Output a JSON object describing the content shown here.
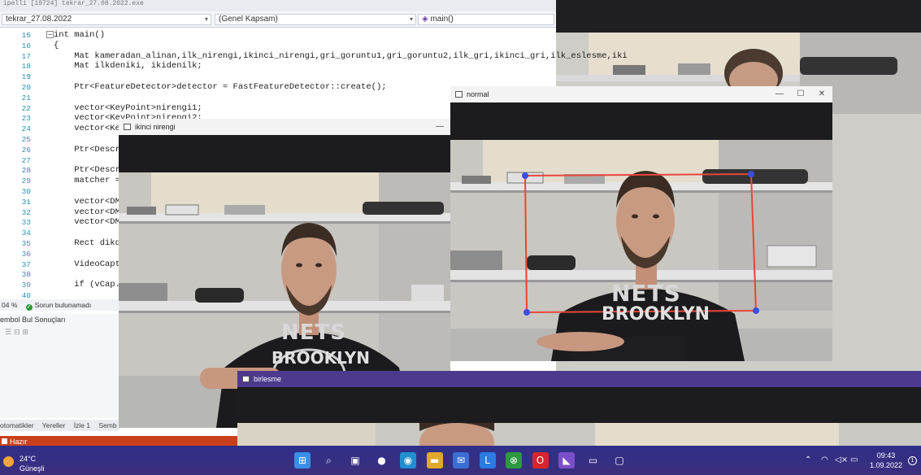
{
  "editor": {
    "tab_text": "ipelli  [19724] tekrar_27.08.2022.exe",
    "file_dropdown": "tekrar_27.08.2022",
    "scope_dropdown": "(Genel Kapsam)",
    "function_dropdown": "main()",
    "lines": [
      {
        "no": "15",
        "code": "int main()"
      },
      {
        "no": "16",
        "code": "{"
      },
      {
        "no": "17",
        "code": "    Mat kameradan_alinan,ilk_nirengi,ikinci_nirengi,gri_goruntu1,gri_goruntu2,ilk_gri,ikinci_gri,ilk_eslesme,iki"
      },
      {
        "no": "18",
        "code": "    Mat ilkdeniki, ikidenilk;"
      },
      {
        "no": "19",
        "code": ""
      },
      {
        "no": "20",
        "code": "    Ptr<FeatureDetector>detector = FastFeatureDetector::create();"
      },
      {
        "no": "21",
        "code": ""
      },
      {
        "no": "22",
        "code": "    vector<KeyPoint>nirengi1;"
      },
      {
        "no": "23",
        "code": "    vector<KeyPoint>nirengi2;"
      },
      {
        "no": "24",
        "code": "    vector<Key"
      },
      {
        "no": "25",
        "code": ""
      },
      {
        "no": "26",
        "code": "    Ptr<Descri"
      },
      {
        "no": "27",
        "code": ""
      },
      {
        "no": "28",
        "code": "    Ptr<Descri"
      },
      {
        "no": "29",
        "code": "    matcher ="
      },
      {
        "no": "30",
        "code": ""
      },
      {
        "no": "31",
        "code": "    vector<DMa"
      },
      {
        "no": "32",
        "code": "    vector<DMa"
      },
      {
        "no": "33",
        "code": "    vector<DMa"
      },
      {
        "no": "34",
        "code": ""
      },
      {
        "no": "35",
        "code": "    Rect dikdo"
      },
      {
        "no": "36",
        "code": ""
      },
      {
        "no": "37",
        "code": "    VideoCaptu"
      },
      {
        "no": "38",
        "code": ""
      },
      {
        "no": "39",
        "code": "    if (vCap.i"
      },
      {
        "no": "40",
        "code": ""
      }
    ],
    "zoom": "04 %",
    "issues": "Sorun bulunamadı",
    "find_panel_title": "embol Bul Sonuçları",
    "bottom_tabs": [
      "otomatikler",
      "Yereller",
      "İzle 1",
      "Semb"
    ],
    "status": "Hazır"
  },
  "windows": {
    "ikinci": {
      "title": "ikinci nirengi"
    },
    "normal": {
      "title": "normal"
    },
    "birlesme": {
      "title": "birlesme"
    }
  },
  "shirt_text": {
    "nets": "NETS",
    "brooklyn": "BROOKLYN"
  },
  "taskbar": {
    "temp": "24°C",
    "condition": "Güneşli",
    "time": "09:43",
    "date": "1.09.2022",
    "notifications": "1",
    "apps": [
      "start-icon",
      "search-icon",
      "task-view-icon",
      "chat-icon",
      "edge-icon",
      "file-explorer-icon",
      "mail-icon",
      "app-l-icon",
      "xbox-icon",
      "opera-icon",
      "visual-studio-icon",
      "console-app-icon",
      "opencv-window-icon"
    ]
  },
  "colors": {
    "status_bar": "#c93f1c",
    "taskbar": "#3b2f7c",
    "roi_rect": "#e8463a",
    "roi_corner": "#3a4ee0",
    "shirt": "#1b1b1d"
  }
}
